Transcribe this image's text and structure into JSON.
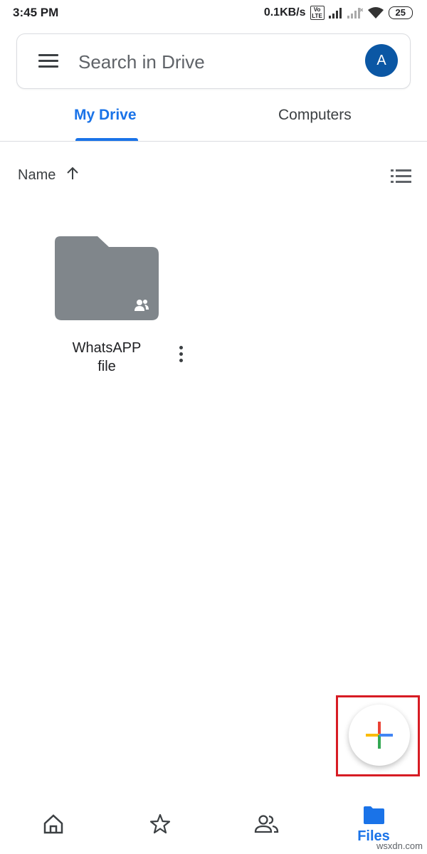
{
  "status_bar": {
    "time": "3:45 PM",
    "speed": "0.1KB/s",
    "volte": "Vo\nLTE",
    "battery": "25"
  },
  "search": {
    "placeholder": "Search in Drive",
    "avatar_letter": "A"
  },
  "tabs": [
    {
      "label": "My Drive",
      "active": true
    },
    {
      "label": "Computers",
      "active": false
    }
  ],
  "sort": {
    "label": "Name",
    "direction_icon": "arrow-up-icon"
  },
  "folders": [
    {
      "name_line1": "WhatsAPP",
      "name_line2": "file",
      "shared": true
    }
  ],
  "bottom_nav": {
    "files_label": "Files"
  },
  "watermark": "wsxdn.com",
  "colors": {
    "accent": "#1a73e8",
    "folder": "#80868b",
    "avatar": "#0b57a4",
    "highlight": "#d71c24"
  }
}
